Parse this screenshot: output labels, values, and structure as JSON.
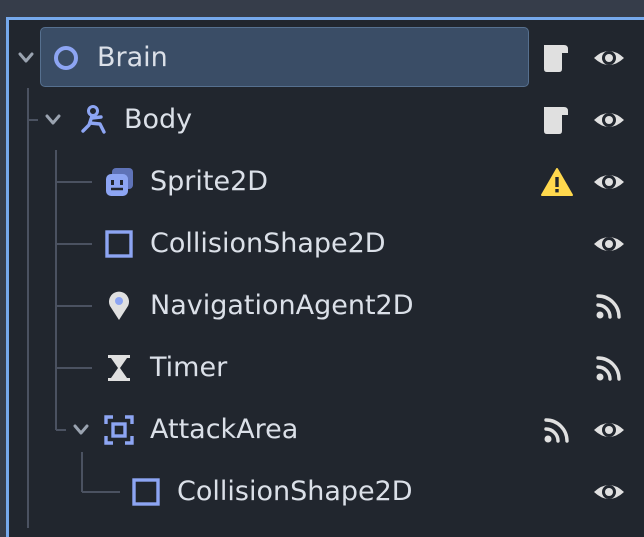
{
  "tree": {
    "nodes": [
      {
        "label": "Brain",
        "icon": "node-circle-icon",
        "right_icons": [
          "script-icon",
          "visibility-eye-icon"
        ],
        "selected": true,
        "expanded": true
      },
      {
        "label": "Body",
        "icon": "character-body-icon",
        "right_icons": [
          "script-icon",
          "visibility-eye-icon"
        ],
        "expanded": true
      },
      {
        "label": "Sprite2D",
        "icon": "sprite-icon",
        "right_icons": [
          "warning-icon",
          "visibility-eye-icon"
        ]
      },
      {
        "label": "CollisionShape2D",
        "icon": "collision-shape-icon",
        "right_icons": [
          "visibility-eye-icon"
        ]
      },
      {
        "label": "NavigationAgent2D",
        "icon": "navigation-pin-icon",
        "right_icons": [
          "signal-icon"
        ]
      },
      {
        "label": "Timer",
        "icon": "hourglass-icon",
        "right_icons": [
          "signal-icon"
        ]
      },
      {
        "label": "AttackArea",
        "icon": "area-icon",
        "right_icons": [
          "signal-icon",
          "visibility-eye-icon"
        ],
        "expanded": true
      },
      {
        "label": "CollisionShape2D",
        "icon": "collision-shape-icon",
        "right_icons": [
          "visibility-eye-icon"
        ]
      }
    ]
  },
  "colors": {
    "panel_bg": "#21262e",
    "selection_bg": "#3a4d66",
    "accent_border": "#76a9ec",
    "node_icon": "#8da5f3",
    "text": "#dbe0e8",
    "warning": "#ffd84d"
  }
}
